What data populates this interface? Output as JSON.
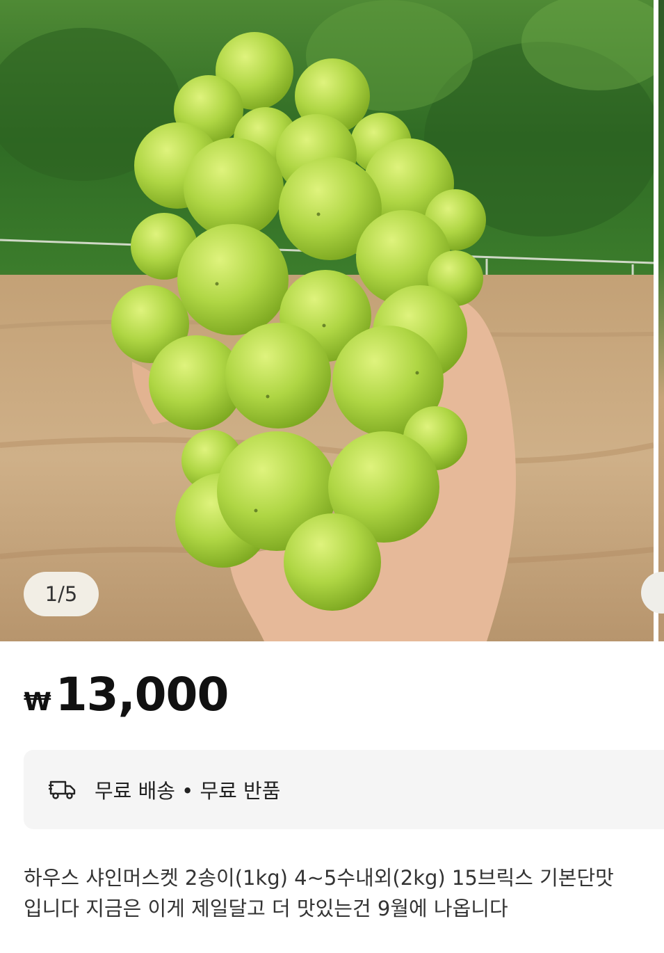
{
  "carousel": {
    "counter": "1/5",
    "image_icon": "grape-photo"
  },
  "price": {
    "currency": "₩",
    "amount": "13,000"
  },
  "shipping": {
    "icon": "truck-icon",
    "text": "무료 배송 • 무료 반품"
  },
  "description": {
    "line1": "하우스 샤인머스켓 2송이(1kg) 4~5수내외(2kg) 15브릭스 기본단맛",
    "line2": "입니다 지금은 이게 제일달고 더 맛있는건 9월에 나옵니다"
  },
  "colors": {
    "grape": "#a9d43f",
    "forest": "#3c7a2c",
    "ground": "#c9a97c"
  }
}
